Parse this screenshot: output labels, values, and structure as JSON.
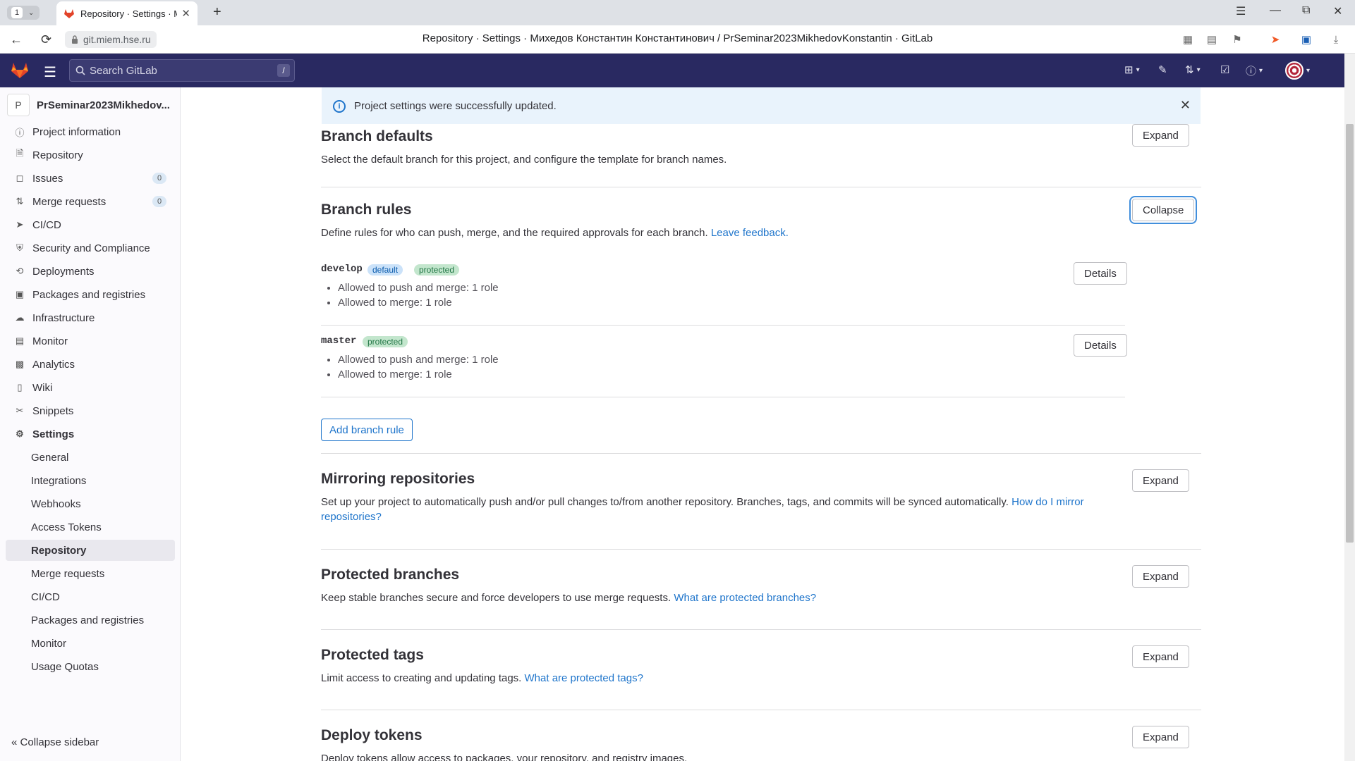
{
  "browser": {
    "tab_count": "1",
    "tab_title": "Repository · Settings · М",
    "url": "git.miem.hse.ru",
    "window_title": "Repository · Settings · Михедов Константин Константинович / PrSeminar2023MikhedovKonstantin · GitLab"
  },
  "header": {
    "search_placeholder": "Search GitLab",
    "search_shortcut": "/"
  },
  "sidebar": {
    "project_initial": "P",
    "project_name": "PrSeminar2023Mikhedov...",
    "items": [
      {
        "label": "Project information",
        "icon": "info-icon"
      },
      {
        "label": "Repository",
        "icon": "doc-icon"
      },
      {
        "label": "Issues",
        "icon": "issues-icon",
        "badge": "0"
      },
      {
        "label": "Merge requests",
        "icon": "merge-icon",
        "badge": "0"
      },
      {
        "label": "CI/CD",
        "icon": "rocket-icon"
      },
      {
        "label": "Security and Compliance",
        "icon": "shield-icon"
      },
      {
        "label": "Deployments",
        "icon": "deploy-icon"
      },
      {
        "label": "Packages and registries",
        "icon": "package-icon"
      },
      {
        "label": "Infrastructure",
        "icon": "cloud-icon"
      },
      {
        "label": "Monitor",
        "icon": "monitor-icon"
      },
      {
        "label": "Analytics",
        "icon": "chart-icon"
      },
      {
        "label": "Wiki",
        "icon": "book-icon"
      },
      {
        "label": "Snippets",
        "icon": "scissors-icon"
      },
      {
        "label": "Settings",
        "icon": "gear-icon"
      }
    ],
    "settings_sub": [
      "General",
      "Integrations",
      "Webhooks",
      "Access Tokens",
      "Repository",
      "Merge requests",
      "CI/CD",
      "Packages and registries",
      "Monitor",
      "Usage Quotas"
    ],
    "collapse_label": "Collapse sidebar"
  },
  "alert": {
    "message": "Project settings were successfully updated."
  },
  "sections": {
    "branch_defaults": {
      "title": "Branch defaults",
      "desc": "Select the default branch for this project, and configure the template for branch names.",
      "button": "Expand"
    },
    "branch_rules": {
      "title": "Branch rules",
      "desc": "Define rules for who can push, merge, and the required approvals for each branch.",
      "link": "Leave feedback.",
      "button": "Collapse",
      "add_button": "Add branch rule",
      "rules": [
        {
          "name": "develop",
          "badges": [
            "default",
            "protected"
          ],
          "lines": [
            "Allowed to push and merge: 1 role",
            "Allowed to merge: 1 role"
          ],
          "button": "Details"
        },
        {
          "name": "master",
          "badges": [
            "protected"
          ],
          "lines": [
            "Allowed to push and merge: 1 role",
            "Allowed to merge: 1 role"
          ],
          "button": "Details"
        }
      ]
    },
    "mirroring": {
      "title": "Mirroring repositories",
      "desc": "Set up your project to automatically push and/or pull changes to/from another repository. Branches, tags, and commits will be synced automatically.",
      "link": "How do I mirror repositories?",
      "button": "Expand"
    },
    "protected_branches": {
      "title": "Protected branches",
      "desc": "Keep stable branches secure and force developers to use merge requests.",
      "link": "What are protected branches?",
      "button": "Expand"
    },
    "protected_tags": {
      "title": "Protected tags",
      "desc": "Limit access to creating and updating tags.",
      "link": "What are protected tags?",
      "button": "Expand"
    },
    "deploy_tokens": {
      "title": "Deploy tokens",
      "desc": "Deploy tokens allow access to packages, your repository, and registry images.",
      "button": "Expand"
    }
  }
}
